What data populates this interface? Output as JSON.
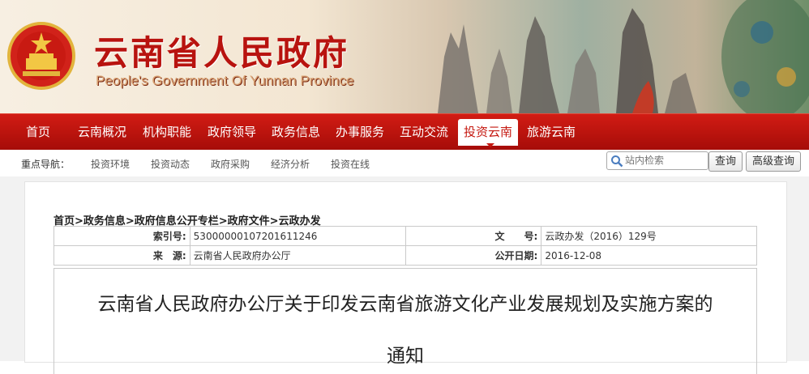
{
  "header": {
    "title_cn": "云南省人民政府",
    "title_en": "People's Government Of Yunnan Province"
  },
  "nav": {
    "items": [
      "首页",
      "云南概况",
      "机构职能",
      "政府领导",
      "政务信息",
      "办事服务",
      "互动交流",
      "投资云南",
      "旅游云南"
    ],
    "active": "投资云南"
  },
  "subnav": {
    "label": "重点导航：",
    "items": [
      "投资环境",
      "投资动态",
      "政府采购",
      "经济分析",
      "投资在线"
    ]
  },
  "search": {
    "placeholder": "站内检索",
    "submit_label": "查询",
    "advanced_label": "高级查询"
  },
  "breadcrumb": "首页>政务信息>政府信息公开专栏>政府文件>云政办发",
  "meta": {
    "index_label": "索引号:",
    "index_value": "53000000107201611246",
    "docno_label": "文　　号:",
    "docno_value": "云政办发（2016）129号",
    "source_label": "来　源:",
    "source_value": "云南省人民政府办公厅",
    "date_label": "公开日期:",
    "date_value": "2016-12-08"
  },
  "document": {
    "title_line1": "云南省人民政府办公厅关于印发云南省旅游文化产业发展规划及实施方案的",
    "title_line2": "通知"
  },
  "colors": {
    "brand_red": "#c51810",
    "nav_red": "#b51510"
  }
}
